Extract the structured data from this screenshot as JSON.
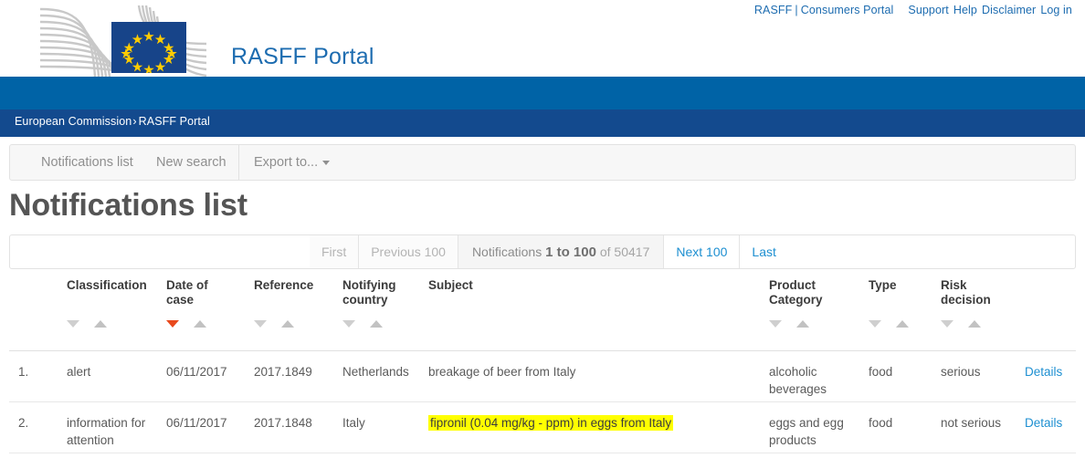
{
  "toplinks": {
    "rasff": "RASFF",
    "separator": "|",
    "consumers_portal": "Consumers Portal",
    "support": "Support",
    "help": "Help",
    "disclaimer": "Disclaimer",
    "login": "Log in"
  },
  "logo": {
    "line1": "European",
    "line2": "Commission",
    "flag_color": "#174489",
    "star_color": "#ffcc00"
  },
  "header": {
    "portal_title": "RASFF Portal",
    "portal_title_color": "#1d6cb0",
    "band_color": "#0063a6",
    "breadcrumb_band_color": "#134a8e"
  },
  "breadcrumb": {
    "root": "European Commission",
    "arrow": "›",
    "current": "RASFF Portal"
  },
  "toolbar": {
    "notifications_list": "Notifications list",
    "new_search": "New search",
    "export_to": "Export to..."
  },
  "page": {
    "title": "Notifications list"
  },
  "pagination": {
    "first": "First",
    "previous": "Previous 100",
    "info_lead": "Notifications",
    "info_range": "1 to 100",
    "info_tail": "of 50417",
    "next": "Next 100",
    "last": "Last",
    "total": 50417,
    "range_start": 1,
    "range_end": 100
  },
  "table": {
    "columns": [
      {
        "label": "Classification",
        "line1": "Classification",
        "line2": "",
        "sortable": true,
        "sort_active": "none"
      },
      {
        "label": "Date of case",
        "line1": "Date of",
        "line2": "case",
        "sortable": true,
        "sort_active": "desc"
      },
      {
        "label": "Reference",
        "line1": "Reference",
        "line2": "",
        "sortable": true,
        "sort_active": "none"
      },
      {
        "label": "Notifying country",
        "line1": "Notifying",
        "line2": "country",
        "sortable": true,
        "sort_active": "none"
      },
      {
        "label": "Subject",
        "line1": "Subject",
        "line2": "",
        "sortable": false,
        "sort_active": "none"
      },
      {
        "label": "Product Category",
        "line1": "Product",
        "line2": "Category",
        "sortable": true,
        "sort_active": "none"
      },
      {
        "label": "Type",
        "line1": "Type",
        "line2": "",
        "sortable": true,
        "sort_active": "none"
      },
      {
        "label": "Risk decision",
        "line1": "Risk",
        "line2": "decision",
        "sortable": true,
        "sort_active": "none"
      }
    ],
    "sort_active_color": "#e8491d",
    "rows": [
      {
        "num": "1.",
        "classification": "alert",
        "date_of_case": "06/11/2017",
        "reference": "2017.1849",
        "notifying_country": "Netherlands",
        "subject": "breakage of beer from Italy",
        "subject_highlighted": false,
        "product_category": "alcoholic beverages",
        "type": "food",
        "risk_decision": "serious",
        "details": "Details"
      },
      {
        "num": "2.",
        "classification": "information for attention",
        "date_of_case": "06/11/2017",
        "reference": "2017.1848",
        "notifying_country": "Italy",
        "subject": "fipronil (0.04 mg/kg - ppm) in eggs from Italy",
        "subject_highlighted": true,
        "product_category": "eggs and egg products",
        "type": "food",
        "risk_decision": "not serious",
        "details": "Details"
      }
    ]
  }
}
